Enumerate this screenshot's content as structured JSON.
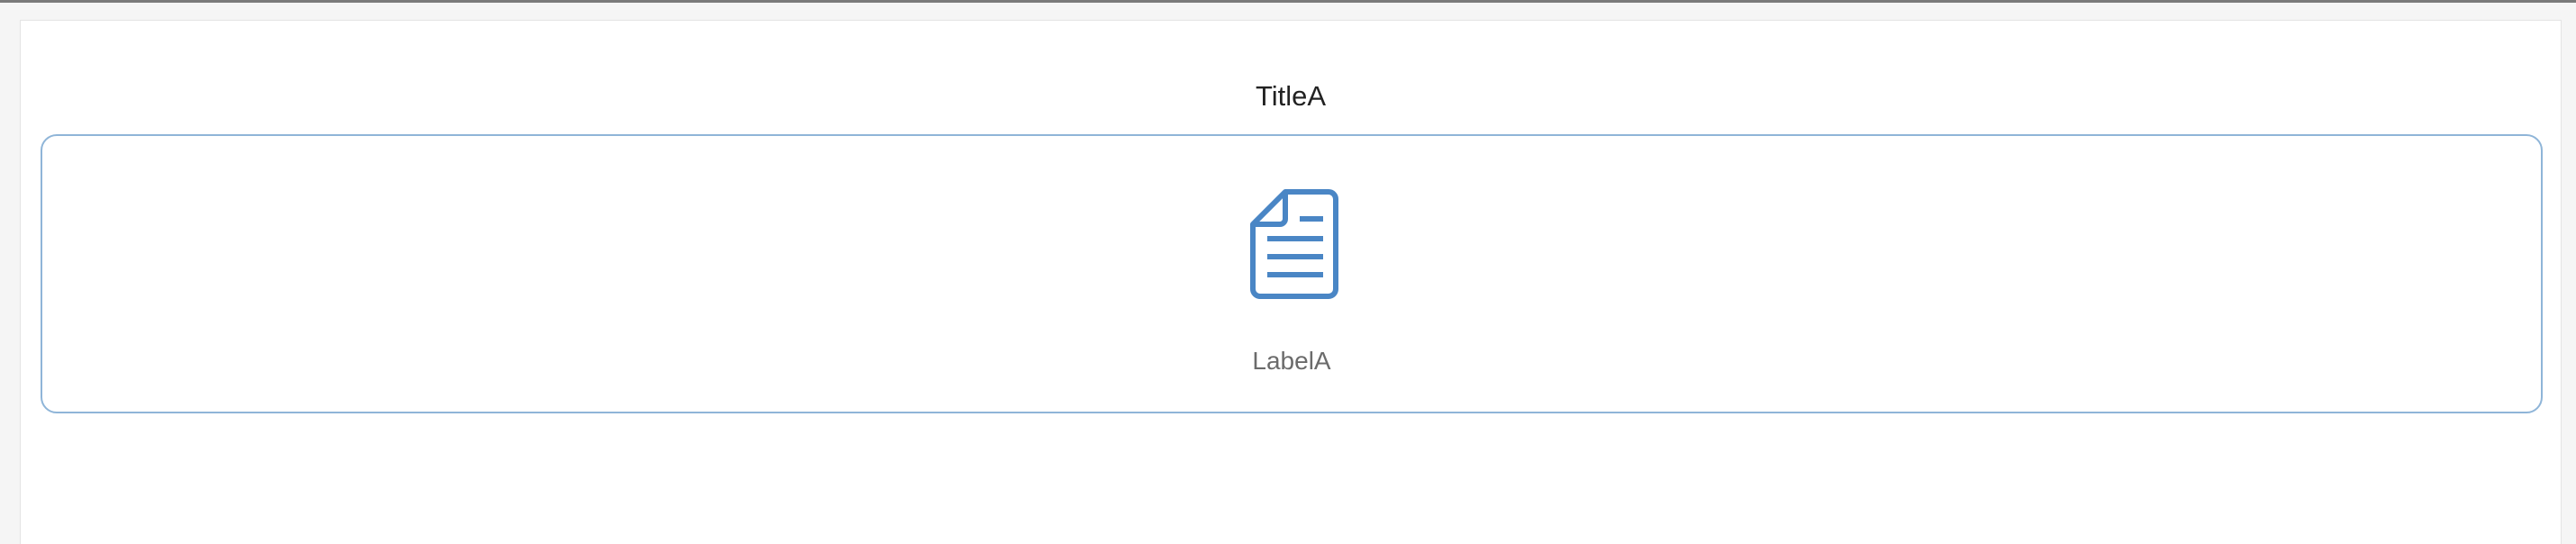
{
  "page": {
    "title": "TitleA"
  },
  "card": {
    "label": "LabelA",
    "icon": "document-icon",
    "accent_color": "#4a86c5",
    "border_color": "#8fb5d8"
  }
}
